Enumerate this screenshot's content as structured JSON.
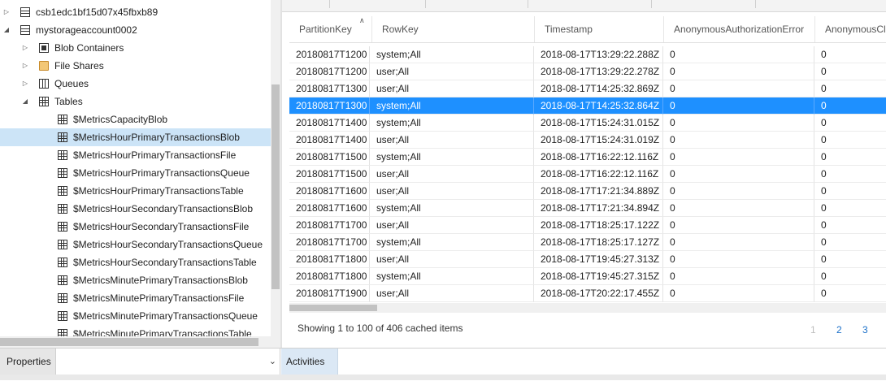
{
  "tree": {
    "nodes": [
      {
        "label": "csb1edc1bf15d07x45fbxb89",
        "icon": "storage-account-icon",
        "expanded": false
      },
      {
        "label": "mystorageaccount0002",
        "icon": "storage-account-icon",
        "expanded": true
      },
      {
        "label": "Blob Containers",
        "icon": "blob-containers-icon",
        "expanded": false
      },
      {
        "label": "File Shares",
        "icon": "file-shares-icon",
        "expanded": false
      },
      {
        "label": "Queues",
        "icon": "queues-icon",
        "expanded": false
      },
      {
        "label": "Tables",
        "icon": "tables-icon",
        "expanded": true
      },
      {
        "label": "$MetricsCapacityBlob",
        "icon": "table-icon"
      },
      {
        "label": "$MetricsHourPrimaryTransactionsBlob",
        "icon": "table-icon",
        "selected": true
      },
      {
        "label": "$MetricsHourPrimaryTransactionsFile",
        "icon": "table-icon"
      },
      {
        "label": "$MetricsHourPrimaryTransactionsQueue",
        "icon": "table-icon"
      },
      {
        "label": "$MetricsHourPrimaryTransactionsTable",
        "icon": "table-icon"
      },
      {
        "label": "$MetricsHourSecondaryTransactionsBlob",
        "icon": "table-icon"
      },
      {
        "label": "$MetricsHourSecondaryTransactionsFile",
        "icon": "table-icon"
      },
      {
        "label": "$MetricsHourSecondaryTransactionsQueue",
        "icon": "table-icon"
      },
      {
        "label": "$MetricsHourSecondaryTransactionsTable",
        "icon": "table-icon"
      },
      {
        "label": "$MetricsMinutePrimaryTransactionsBlob",
        "icon": "table-icon"
      },
      {
        "label": "$MetricsMinutePrimaryTransactionsFile",
        "icon": "table-icon"
      },
      {
        "label": "$MetricsMinutePrimaryTransactionsQueue",
        "icon": "table-icon"
      },
      {
        "label": "$MetricsMinutePrimaryTransactionsTable",
        "icon": "table-icon"
      }
    ]
  },
  "grid": {
    "columns": [
      "PartitionKey",
      "RowKey",
      "Timestamp",
      "AnonymousAuthorizationError",
      "AnonymousCl"
    ],
    "sort_icon": "sort-ascending-icon",
    "rows": [
      [
        "20180817T1200",
        "system;All",
        "2018-08-17T13:29:22.288Z",
        "0",
        "0"
      ],
      [
        "20180817T1200",
        "user;All",
        "2018-08-17T13:29:22.278Z",
        "0",
        "0"
      ],
      [
        "20180817T1300",
        "user;All",
        "2018-08-17T14:25:32.869Z",
        "0",
        "0"
      ],
      [
        "20180817T1300",
        "system;All",
        "2018-08-17T14:25:32.864Z",
        "0",
        "0"
      ],
      [
        "20180817T1400",
        "system;All",
        "2018-08-17T15:24:31.015Z",
        "0",
        "0"
      ],
      [
        "20180817T1400",
        "user;All",
        "2018-08-17T15:24:31.019Z",
        "0",
        "0"
      ],
      [
        "20180817T1500",
        "system;All",
        "2018-08-17T16:22:12.116Z",
        "0",
        "0"
      ],
      [
        "20180817T1500",
        "user;All",
        "2018-08-17T16:22:12.116Z",
        "0",
        "0"
      ],
      [
        "20180817T1600",
        "user;All",
        "2018-08-17T17:21:34.889Z",
        "0",
        "0"
      ],
      [
        "20180817T1600",
        "system;All",
        "2018-08-17T17:21:34.894Z",
        "0",
        "0"
      ],
      [
        "20180817T1700",
        "user;All",
        "2018-08-17T18:25:17.122Z",
        "0",
        "0"
      ],
      [
        "20180817T1700",
        "system;All",
        "2018-08-17T18:25:17.127Z",
        "0",
        "0"
      ],
      [
        "20180817T1800",
        "user;All",
        "2018-08-17T19:45:27.313Z",
        "0",
        "0"
      ],
      [
        "20180817T1800",
        "system;All",
        "2018-08-17T19:45:27.315Z",
        "0",
        "0"
      ],
      [
        "20180817T1900",
        "user;All",
        "2018-08-17T20:22:17.455Z",
        "0",
        "0"
      ]
    ],
    "selected_row_index": 3,
    "status_text": "Showing 1 to 100 of 406 cached items",
    "pages": [
      "1",
      "2",
      "3"
    ],
    "current_page": "1"
  },
  "bottom": {
    "properties_label": "Properties",
    "properties_dropdown_icon": "chevron-down-icon",
    "activities_label": "Activities"
  },
  "colors": {
    "selection_blue": "#1e90ff",
    "tree_selected": "#cce4f7",
    "link_blue": "#1a6fc9"
  }
}
